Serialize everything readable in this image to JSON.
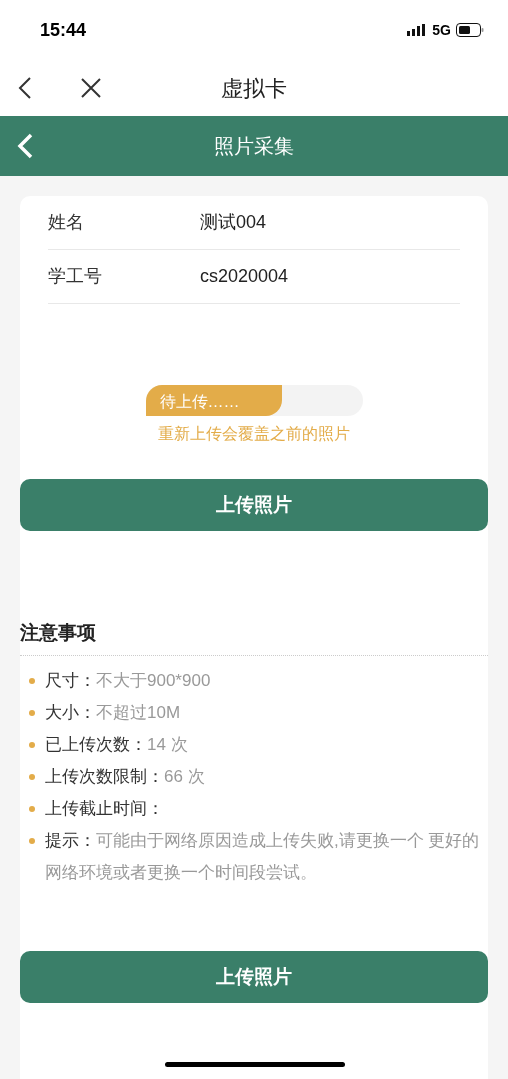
{
  "status_bar": {
    "time": "15:44",
    "network": "5G"
  },
  "nav_bar": {
    "title": "虚拟卡"
  },
  "header": {
    "title": "照片采集"
  },
  "info_rows": [
    {
      "label": "姓名",
      "value": "测试004"
    },
    {
      "label": "学工号",
      "value": "cs2020004"
    }
  ],
  "upload_status": {
    "label": "待上传……",
    "level": 0.63,
    "hint": "重新上传会覆盖之前的照片"
  },
  "upload_button_top": "上传照片",
  "notes": {
    "title": "注意事项",
    "items": [
      {
        "label": "尺寸：",
        "value": "不大于900*900"
      },
      {
        "label": "大小：",
        "value": "不超过10M"
      },
      {
        "label": "已上传次数：",
        "value": "14 次"
      },
      {
        "label": "上传次数限制：",
        "value": "66 次"
      },
      {
        "label": "上传截止时间：",
        "value": ""
      },
      {
        "label": "提示：",
        "value": "可能由于网络原因造成上传失败,请更换一个 更好的网络环境或者更换一个时间段尝试。"
      }
    ]
  },
  "upload_button_bottom": "上传照片"
}
